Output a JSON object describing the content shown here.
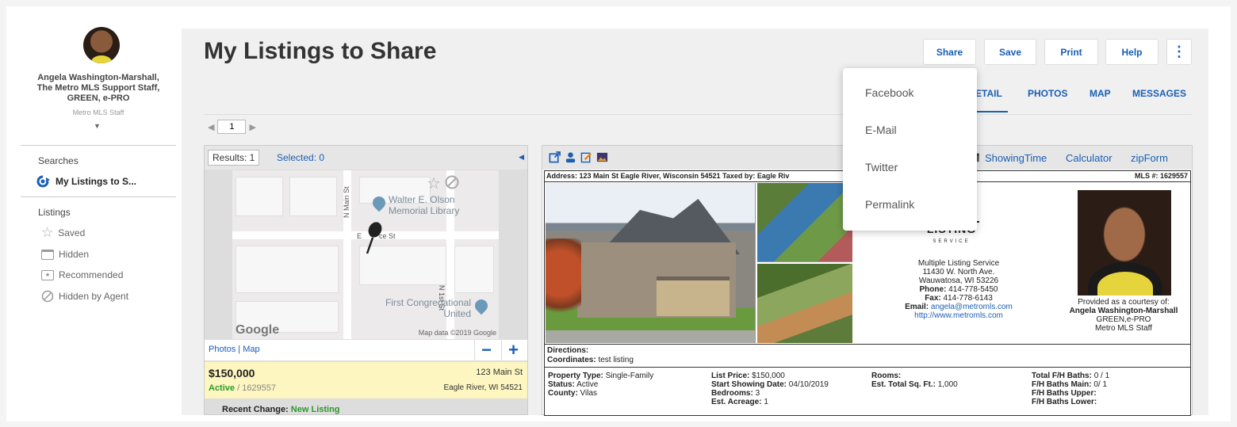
{
  "user": {
    "name_line1": "Angela Washington-Marshall,",
    "name_line2": "The Metro MLS Support Staff,",
    "name_line3": "GREEN, e-PRO",
    "role": "Metro MLS Staff"
  },
  "sidebar": {
    "searches_heading": "Searches",
    "search_item": "My Listings to S...",
    "listings_heading": "Listings",
    "items": [
      {
        "label": "Saved",
        "icon": "star-icon"
      },
      {
        "label": "Hidden",
        "icon": "hidden-icon"
      },
      {
        "label": "Recommended",
        "icon": "recommended-icon"
      },
      {
        "label": "Hidden by Agent",
        "icon": "block-icon"
      }
    ]
  },
  "header": {
    "title": "My Listings to Share",
    "buttons": {
      "share": "Share",
      "save": "Save",
      "print": "Print",
      "help": "Help"
    }
  },
  "share_menu": [
    "Facebook",
    "E-Mail",
    "Twitter",
    "Permalink"
  ],
  "tabs": [
    "DETAIL",
    "PHOTOS",
    "MAP",
    "MESSAGES"
  ],
  "tabs_visible": [
    "ETAIL",
    "PHOTOS",
    "MAP",
    "MESSAGES"
  ],
  "pager": {
    "page": "1"
  },
  "results": {
    "results_tab": "Results: 1",
    "selected_tab": "Selected: 0",
    "map": {
      "poi1_line1": "Walter E. Olson",
      "poi1_line2": "Memorial Library",
      "poi2_line1": "First Congregational",
      "poi2_line2": "United",
      "street_main": "N Main St",
      "street_1st": "N 1st St",
      "street_e": "E",
      "street_e2": "ce St",
      "google": "Google",
      "credit": "Map data ©2019 Google"
    },
    "map_links": "Photos | Map",
    "listing": {
      "price": "$150,000",
      "status": "Active",
      "mls": " / 1629557",
      "address1": "123 Main St",
      "address2": "Eagle River, WI 54521"
    },
    "recent_label": "Recent Change: ",
    "recent_value": "New Listing"
  },
  "detail": {
    "toolbar_links": {
      "showingtime": "ShowingTime",
      "calculator": "Calculator",
      "zipform": "zipForm"
    },
    "address_line": "Address: 123 Main St Eagle River, Wisconsin 54521 Taxed by: Eagle Riv",
    "mls_line": "MLS #: 1629557",
    "office": {
      "logo": "LISTING",
      "logo_sub": "SERVICE",
      "line1": "Multiple Listing Service",
      "line2": "11430 W. North Ave.",
      "line3": "Wauwatosa, WI 53226",
      "phone_label": "Phone:",
      "phone": " 414-778-5450",
      "fax_label": "Fax:",
      "fax": " 414-778-6143",
      "email_label": "Email:",
      "email": " angela@metromls.com",
      "web": "http://www.metromls.com"
    },
    "agent": {
      "courtesy": "Provided as a courtesy of:",
      "name": "Angela Washington-Marshall",
      "cred": "GREEN,e-PRO",
      "role": "Metro MLS Staff"
    },
    "directions_label": "Directions:",
    "coordinates_label": "Coordinates:",
    "coordinates_value": " test listing",
    "facts": {
      "property_type_label": "Property Type:",
      "property_type": " Single-Family",
      "status_label": "Status:",
      "status": " Active",
      "county_label": "County:",
      "county": " Vilas",
      "list_price_label": "List Price:",
      "list_price": " $150,000",
      "start_showing_label": "Start Showing Date:",
      "start_showing": " 04/10/2019",
      "bedrooms_label": "Bedrooms:",
      "bedrooms": " 3",
      "acreage_label": "Est. Acreage:",
      "acreage": " 1",
      "rooms_label": "Rooms:",
      "sqft_label": "Est. Total Sq. Ft.:",
      "sqft": " 1,000",
      "total_baths_label": "Total F/H Baths:",
      "total_baths": " 0 / 1",
      "baths_main_label": "F/H Baths Main:",
      "baths_main": " 0/ 1",
      "baths_upper_label": "F/H Baths Upper:",
      "baths_lower_label": "F/H Baths Lower:"
    }
  },
  "colors": {
    "accent": "#1a5fb4",
    "active_green": "#2a9a2a",
    "highlight": "#fdf6c0"
  }
}
